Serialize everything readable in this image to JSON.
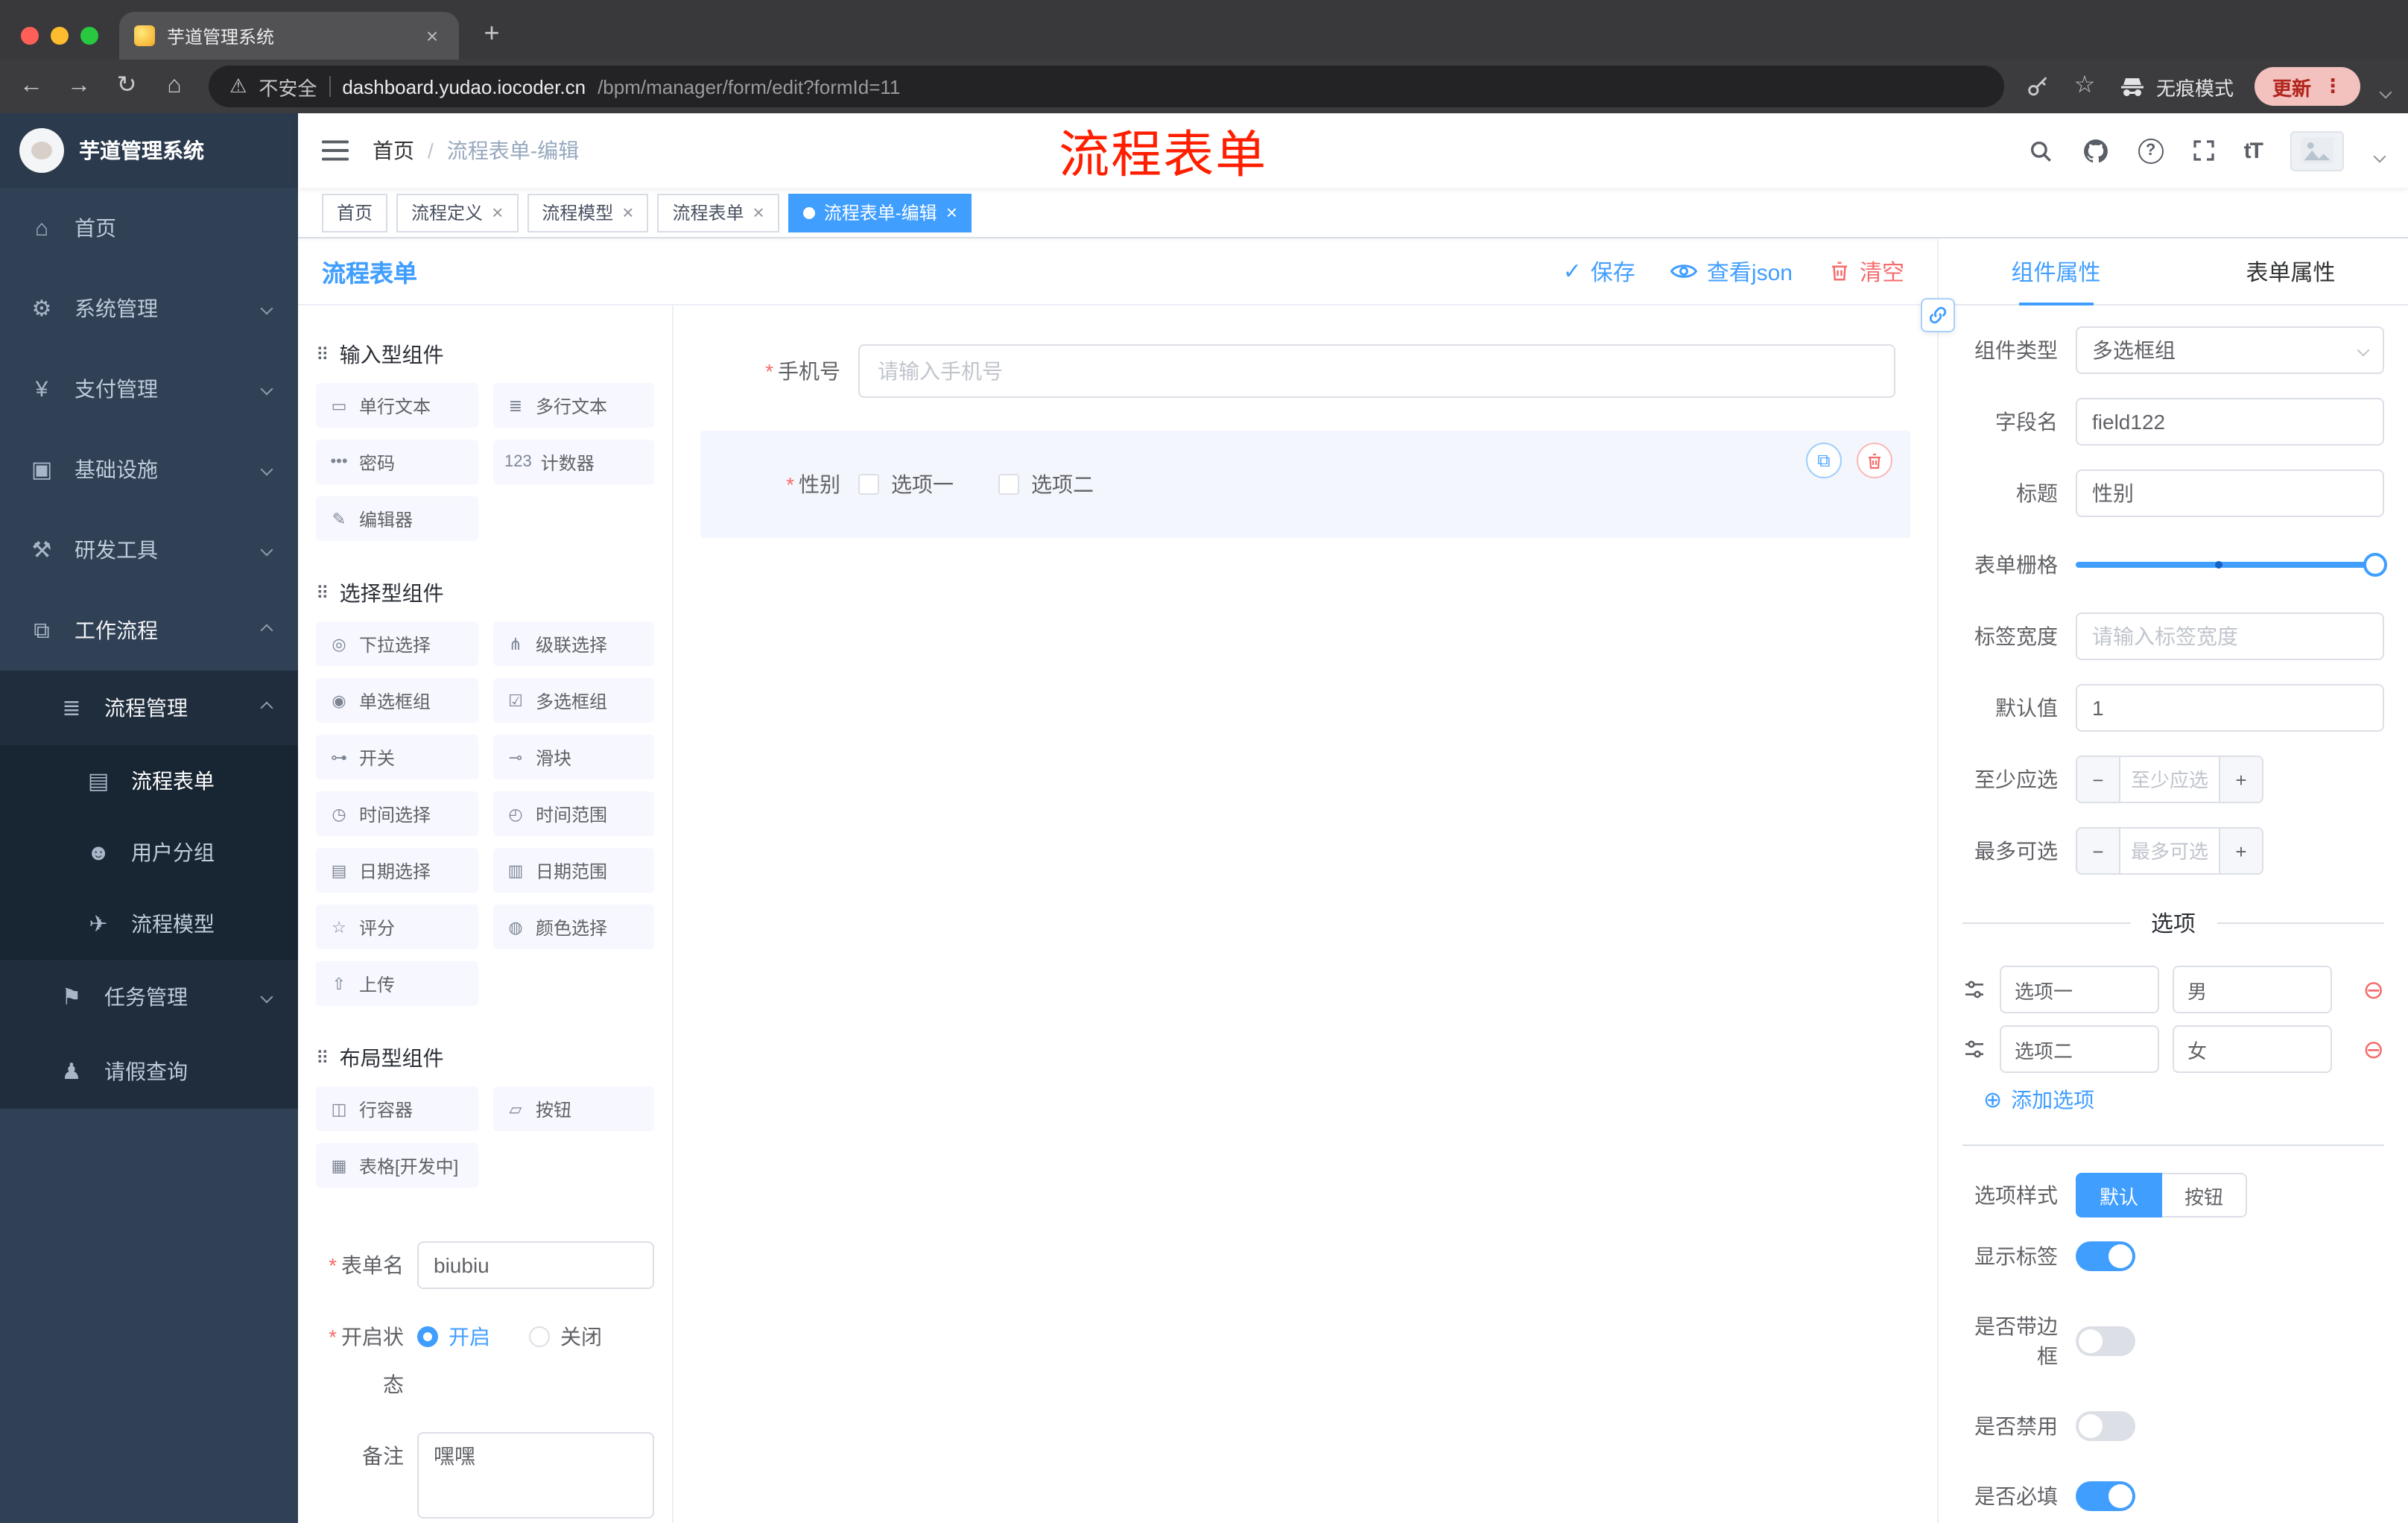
{
  "browser": {
    "tab_title": "芋道管理系统",
    "security": "不安全",
    "url_domain": "dashboard.yudao.iocoder.cn",
    "url_path": "/bpm/manager/form/edit?formId=11",
    "incognito": "无痕模式",
    "update": "更新"
  },
  "sidebar": {
    "logo_title": "芋道管理系统",
    "items": [
      {
        "label": "首页"
      },
      {
        "label": "系统管理"
      },
      {
        "label": "支付管理"
      },
      {
        "label": "基础设施"
      },
      {
        "label": "研发工具"
      },
      {
        "label": "工作流程"
      },
      {
        "label": "流程管理"
      },
      {
        "label": "流程表单"
      },
      {
        "label": "用户分组"
      },
      {
        "label": "流程模型"
      },
      {
        "label": "任务管理"
      },
      {
        "label": "请假查询"
      }
    ]
  },
  "header": {
    "breadcrumb_home": "首页",
    "breadcrumb_sep": "/",
    "breadcrumb_current": "流程表单-编辑",
    "annotation": "流程表单"
  },
  "tags": [
    {
      "label": "首页"
    },
    {
      "label": "流程定义"
    },
    {
      "label": "流程模型"
    },
    {
      "label": "流程表单"
    },
    {
      "label": "流程表单-编辑"
    }
  ],
  "designer": {
    "panel_title": "流程表单",
    "toolbar": {
      "save": "保存",
      "view_json": "查看json",
      "clear": "清空"
    },
    "palette": {
      "sections": [
        {
          "title": "输入型组件",
          "items": [
            {
              "label": "单行文本",
              "icon": "▭"
            },
            {
              "label": "多行文本",
              "icon": "≣"
            },
            {
              "label": "密码",
              "icon": "•••"
            },
            {
              "label": "计数器",
              "icon": "123"
            },
            {
              "label": "编辑器",
              "icon": "✎"
            }
          ]
        },
        {
          "title": "选择型组件",
          "items": [
            {
              "label": "下拉选择",
              "icon": "◎"
            },
            {
              "label": "级联选择",
              "icon": "⋔"
            },
            {
              "label": "单选框组",
              "icon": "◉"
            },
            {
              "label": "多选框组",
              "icon": "☑"
            },
            {
              "label": "开关",
              "icon": "⊶"
            },
            {
              "label": "滑块",
              "icon": "⊸"
            },
            {
              "label": "时间选择",
              "icon": "◷"
            },
            {
              "label": "时间范围",
              "icon": "◴"
            },
            {
              "label": "日期选择",
              "icon": "▤"
            },
            {
              "label": "日期范围",
              "icon": "▥"
            },
            {
              "label": "评分",
              "icon": "☆"
            },
            {
              "label": "颜色选择",
              "icon": "◍"
            },
            {
              "label": "上传",
              "icon": "⇧"
            }
          ]
        },
        {
          "title": "布局型组件",
          "items": [
            {
              "label": "行容器",
              "icon": "◫"
            },
            {
              "label": "按钮",
              "icon": "▱"
            },
            {
              "label": "表格[开发中]",
              "icon": "▦"
            }
          ]
        }
      ]
    },
    "meta": {
      "name_label": "表单名",
      "name_value": "biubiu",
      "status_label": "开启状态",
      "status_on": "开启",
      "status_off": "关闭",
      "status_selected": "开启",
      "remark_label": "备注",
      "remark_value": "嘿嘿"
    },
    "canvas": {
      "phone_label": "手机号",
      "phone_placeholder": "请输入手机号",
      "gender_label": "性别",
      "gender_option1": "选项一",
      "gender_option2": "选项二"
    }
  },
  "props": {
    "tab_component": "组件属性",
    "tab_form": "表单属性",
    "active_tab": "组件属性",
    "component_type_label": "组件类型",
    "component_type_value": "多选框组",
    "field_name_label": "字段名",
    "field_name_value": "field122",
    "title_label": "标题",
    "title_value": "性别",
    "grid_label": "表单栅格",
    "label_width_label": "标签宽度",
    "label_width_placeholder": "请输入标签宽度",
    "default_label": "默认值",
    "default_value": "1",
    "min_label": "至少应选",
    "min_placeholder": "至少应选",
    "max_label": "最多可选",
    "max_placeholder": "最多可选",
    "options_divider": "选项",
    "options": [
      {
        "label": "选项一",
        "value": "男"
      },
      {
        "label": "选项二",
        "value": "女"
      }
    ],
    "add_option": "添加选项",
    "style_label": "选项样式",
    "style_default": "默认",
    "style_button": "按钮",
    "style_selected": "默认",
    "switch_show_label": "显示标签",
    "switch_border": "是否带边框",
    "switch_disabled": "是否禁用",
    "switch_required": "是否必填",
    "switch_states": {
      "show_label": true,
      "border": false,
      "disabled": false,
      "required": true
    }
  },
  "icons": {
    "back": "←",
    "forward": "→",
    "reload": "↻",
    "home": "⌂",
    "warning": "⚠",
    "star": "☆",
    "close": "×",
    "new_tab": "+",
    "menu_dots": "⋮",
    "check": "✓",
    "copy": "⧉",
    "add_circle": "⊕",
    "remove_circle": "⊖",
    "minus": "−",
    "plus": "+",
    "grip": "⠿",
    "font_size": "tT",
    "sidebar": {
      "dashboard": "⌂",
      "system": "⚙",
      "payment": "¥",
      "infra": "▣",
      "devtools": "⚒",
      "workflow": "⧉",
      "process": "≣",
      "form": "▤",
      "group": "☻",
      "model": "✈",
      "task": "⚑",
      "person": "♟"
    }
  },
  "colors": {
    "accent": "#409eff",
    "danger": "#f56c6c",
    "annotation_red": "#ff1e00",
    "sidebar_bg": "#304156",
    "sidebar_sub_bg": "#1f2d3d",
    "tag_active": "#409eff"
  }
}
